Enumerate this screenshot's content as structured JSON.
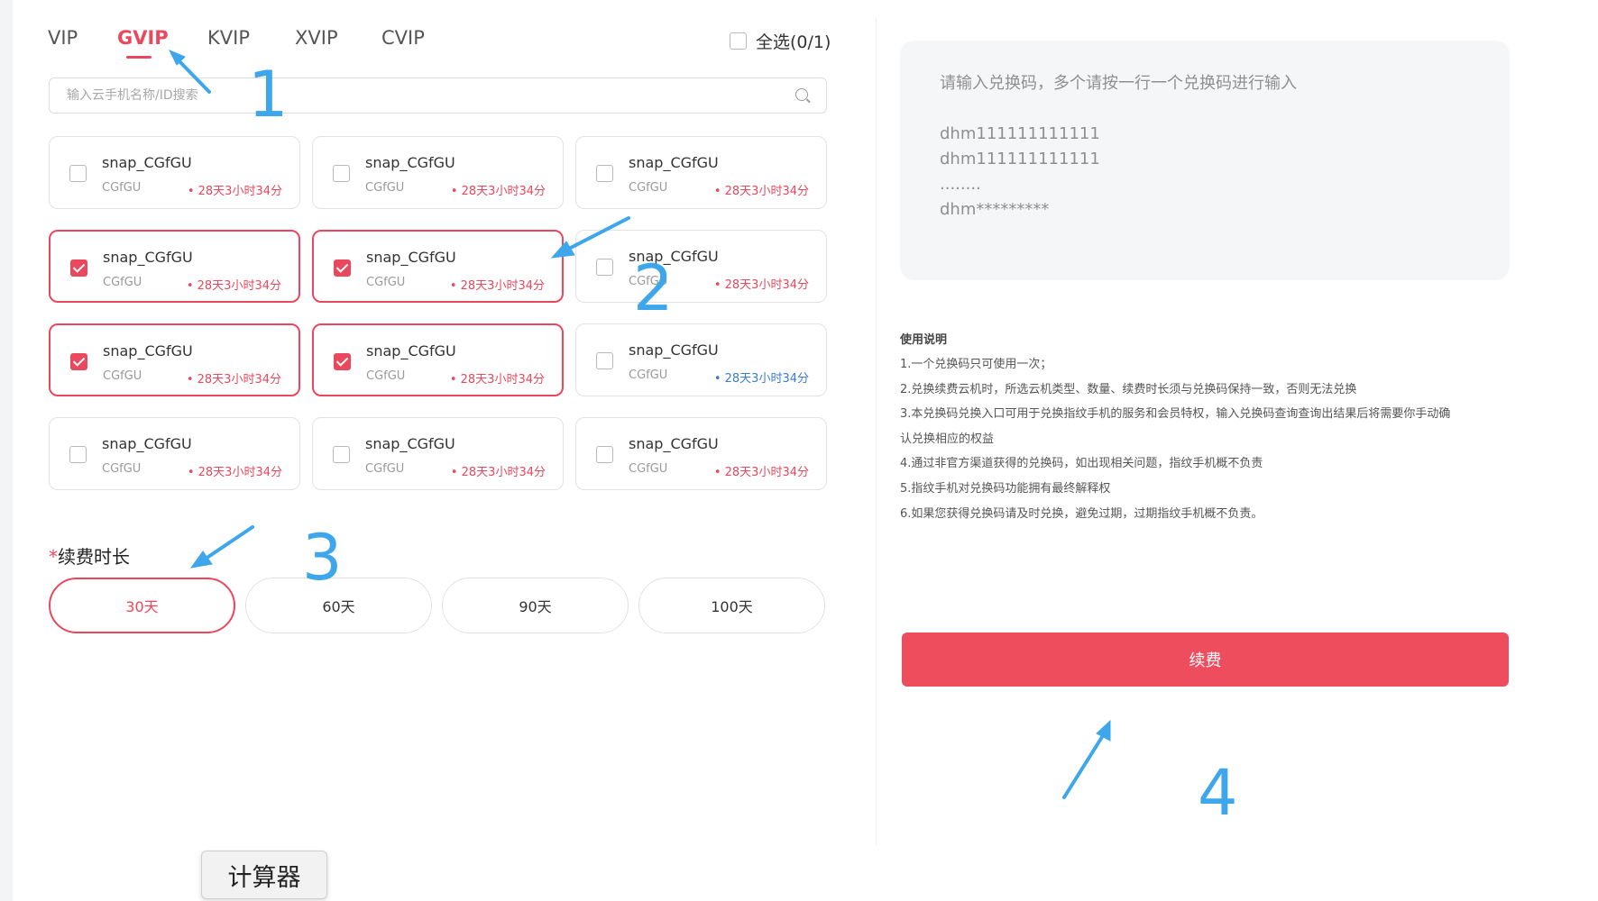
{
  "tabs": [
    {
      "label": "VIP",
      "active": false
    },
    {
      "label": "GVIP",
      "active": true
    },
    {
      "label": "KVIP",
      "active": false
    },
    {
      "label": "XVIP",
      "active": false
    },
    {
      "label": "CVIP",
      "active": false
    }
  ],
  "select_all": {
    "label": "全选(0/1)",
    "checked": false
  },
  "search": {
    "placeholder": "输入云手机名称/ID搜索",
    "value": ""
  },
  "devices": [
    {
      "name": "snap_CGfGU",
      "id": "CGfGU",
      "time": "• 28天3小时34分",
      "selected": false,
      "time_color": "red"
    },
    {
      "name": "snap_CGfGU",
      "id": "CGfGU",
      "time": "• 28天3小时34分",
      "selected": false,
      "time_color": "red"
    },
    {
      "name": "snap_CGfGU",
      "id": "CGfGU",
      "time": "• 28天3小时34分",
      "selected": false,
      "time_color": "red"
    },
    {
      "name": "snap_CGfGU",
      "id": "CGfGU",
      "time": "• 28天3小时34分",
      "selected": true,
      "time_color": "red"
    },
    {
      "name": "snap_CGfGU",
      "id": "CGfGU",
      "time": "• 28天3小时34分",
      "selected": true,
      "time_color": "red"
    },
    {
      "name": "snap_CGfGU",
      "id": "CGfGU",
      "time": "• 28天3小时34分",
      "selected": false,
      "time_color": "red"
    },
    {
      "name": "snap_CGfGU",
      "id": "CGfGU",
      "time": "• 28天3小时34分",
      "selected": true,
      "time_color": "red"
    },
    {
      "name": "snap_CGfGU",
      "id": "CGfGU",
      "time": "• 28天3小时34分",
      "selected": true,
      "time_color": "red"
    },
    {
      "name": "snap_CGfGU",
      "id": "CGfGU",
      "time": "• 28天3小时34分",
      "selected": false,
      "time_color": "blue"
    },
    {
      "name": "snap_CGfGU",
      "id": "CGfGU",
      "time": "• 28天3小时34分",
      "selected": false,
      "time_color": "red"
    },
    {
      "name": "snap_CGfGU",
      "id": "CGfGU",
      "time": "• 28天3小时34分",
      "selected": false,
      "time_color": "red"
    },
    {
      "name": "snap_CGfGU",
      "id": "CGfGU",
      "time": "• 28天3小时34分",
      "selected": false,
      "time_color": "red"
    }
  ],
  "duration": {
    "required_mark": "*",
    "label": "续费时长",
    "options": [
      {
        "label": "30天",
        "active": true
      },
      {
        "label": "60天",
        "active": false
      },
      {
        "label": "90天",
        "active": false
      },
      {
        "label": "100天",
        "active": false
      }
    ]
  },
  "redeem": {
    "placeholder": "请输入兑换码，多个请按一行一个兑换码进行输入\n\ndhm111111111111\ndhm111111111111\n........\ndhm*********"
  },
  "instructions": {
    "title": "使用说明",
    "lines": [
      "1.一个兑换码只可使用一次；",
      "2.兑换续费云机时，所选云机类型、数量、续费时长须与兑换码保持一致，否则无法兑换",
      "3.本兑换码兑换入口可用于兑换指纹手机的服务和会员特权，输入兑换码查询查询出结果后将需要你手动确",
      "认兑换相应的权益",
      "4.通过非官方渠道获得的兑换码，如出现相关问题，指纹手机概不负责",
      "5.指纹手机对兑换码功能拥有最终解释权",
      "6.如果您获得兑换码请及时兑换，避免过期，过期指纹手机概不负责。"
    ]
  },
  "renew_button": {
    "label": "续费"
  },
  "annotations": [
    "1",
    "2",
    "3",
    "4"
  ],
  "tooltip": {
    "text": "计算器"
  },
  "colors": {
    "accent": "#e9485d",
    "button": "#ee4d5e",
    "annotation": "#3ea6ea",
    "blue_time": "#3a7bd5"
  }
}
